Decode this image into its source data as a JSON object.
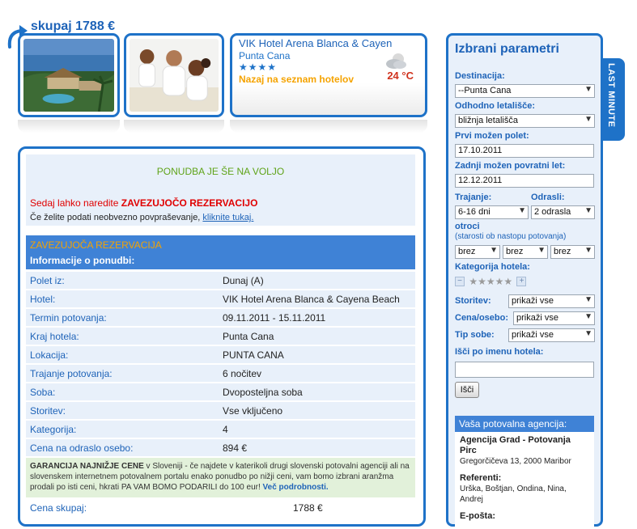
{
  "top": {
    "price": "skupaj 1788 €"
  },
  "hotel_card": {
    "name": "VIK Hotel Arena Blanca & Cayen",
    "location": "Punta Cana",
    "stars": "★★★★",
    "back_link": "Nazaj na seznam hotelov",
    "temperature": "24 °C"
  },
  "offer": {
    "available_title": "PONUDBA JE ŠE NA VOLJO",
    "reserve_prefix": "Sedaj lahko naredite ",
    "reserve_strong": "ZAVEZUJOČO REZERVACIJO",
    "inquiry_text": "Če želite podati neobvezno povpraševanje, ",
    "inquiry_link": "kliknite tukaj.",
    "reservation_title": "ZAVEZUJOČA REZERVACIJA",
    "info_title": "Informacije o ponudbi:",
    "rows": [
      {
        "label": "Polet iz:",
        "value": "Dunaj (A)"
      },
      {
        "label": "Hotel:",
        "value": "VIK Hotel Arena Blanca & Cayena Beach"
      },
      {
        "label": "Termin potovanja:",
        "value": "09.11.2011 - 15.11.2011"
      },
      {
        "label": "Kraj hotela:",
        "value": "Punta Cana"
      },
      {
        "label": "Lokacija:",
        "value": "PUNTA CANA"
      },
      {
        "label": "Trajanje potovanja:",
        "value": "6 nočitev"
      },
      {
        "label": "Soba:",
        "value": "Dvoposteljna soba"
      },
      {
        "label": "Storitev:",
        "value": "Vse vključeno"
      },
      {
        "label": "Kategorija:",
        "value": "4"
      },
      {
        "label": "Cena na odraslo osebo:",
        "value": "894 €"
      }
    ],
    "guarantee_strong": "GARANCIJA NAJNIŽJE CENE",
    "guarantee_text": " v Sloveniji - če najdete v katerikoli drugi slovenski potovalni agenciji ali na slovenskem internetnem potovalnem portalu enako ponudbo po nižji ceni, vam bomo izbrani aranžma prodali po isti ceni, hkrati PA VAM BOMO PODARILI do 100 eur! ",
    "guarantee_more": "Več podrobnosti.",
    "total_label": "Cena skupaj:",
    "total_value": "1788 €"
  },
  "sidebar": {
    "title": "Izbrani parametri",
    "destination_label": "Destinacija:",
    "destination_value": "--Punta Cana",
    "airport_label": "Odhodno letališče:",
    "airport_value": "bližnja letališča",
    "first_flight_label": "Prvi možen polet:",
    "first_flight_value": "17.10.2011",
    "last_flight_label": "Zadnji možen povratni let:",
    "last_flight_value": "12.12.2011",
    "duration_label": "Trajanje:",
    "duration_value": "6-16 dni",
    "adults_label": "Odrasli:",
    "adults_value": "2 odrasla",
    "children_label": "otroci",
    "children_note": "(starosti ob nastopu potovanja)",
    "child_values": [
      "brez",
      "brez",
      "brez"
    ],
    "category_label": "Kategorija hotela:",
    "category_stars": "★★★★★",
    "minus": "−",
    "plus": "+",
    "service_label": "Storitev:",
    "service_value": "prikaži vse",
    "price_label": "Cena/osebo:",
    "price_value": "prikaži vse",
    "room_label": "Tip sobe:",
    "room_value": "prikaži vse",
    "hotel_search_label": "Išči po imenu hotela:",
    "hotel_search_value": "",
    "search_button": "Išči",
    "agency_title": "Vaša potovalna agencija:",
    "agency_name": "Agencija Grad - Potovanja Pirc",
    "agency_address": "Gregorčičeva 13, 2000 Maribor",
    "referents_label": "Referenti:",
    "referents_value": "Urška, Boštjan, Ondina, Nina, Andrej",
    "email_label": "E-pošta:"
  },
  "last_minute_tab": "LAST MINUTE",
  "colors": {
    "accent": "#1e72c8",
    "header_bar": "#3f82d6",
    "panel_bg": "#e8f0fa",
    "available_green": "#5fa318",
    "warning_red": "#e00000",
    "orange": "#f5a300"
  }
}
